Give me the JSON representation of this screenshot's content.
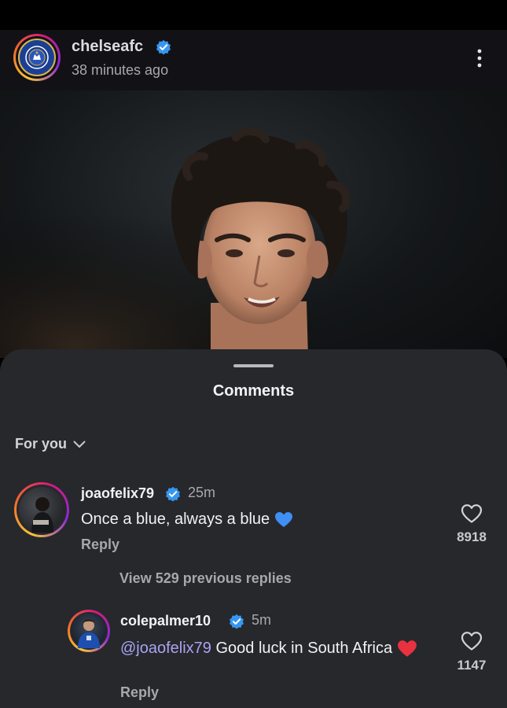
{
  "post": {
    "username": "chelseafc",
    "timestamp": "38 minutes ago"
  },
  "comments_sheet": {
    "title": "Comments",
    "filter_label": "For you",
    "view_replies": "View 529 previous replies"
  },
  "comments": [
    {
      "username": "joaofelix79",
      "time": "25m",
      "text": "Once a blue, always a blue",
      "emoji": "blue-heart",
      "reply_label": "Reply",
      "likes": "8918"
    },
    {
      "username": "colepalmer10",
      "time": "5m",
      "mention": "@joaofelix79",
      "text": " Good luck in South Africa",
      "emoji": "red-heart",
      "reply_label": "Reply",
      "likes": "1147"
    }
  ],
  "icons": {
    "verified": "verified-badge-icon",
    "more": "more-options-icon",
    "like": "heart-outline-icon",
    "filter": "chevron-down-icon"
  },
  "colors": {
    "verified_blue": "#3797f0",
    "mention": "#a9a4f2",
    "blue_heart": "#3f8ff5",
    "red_heart": "#e8323f"
  }
}
